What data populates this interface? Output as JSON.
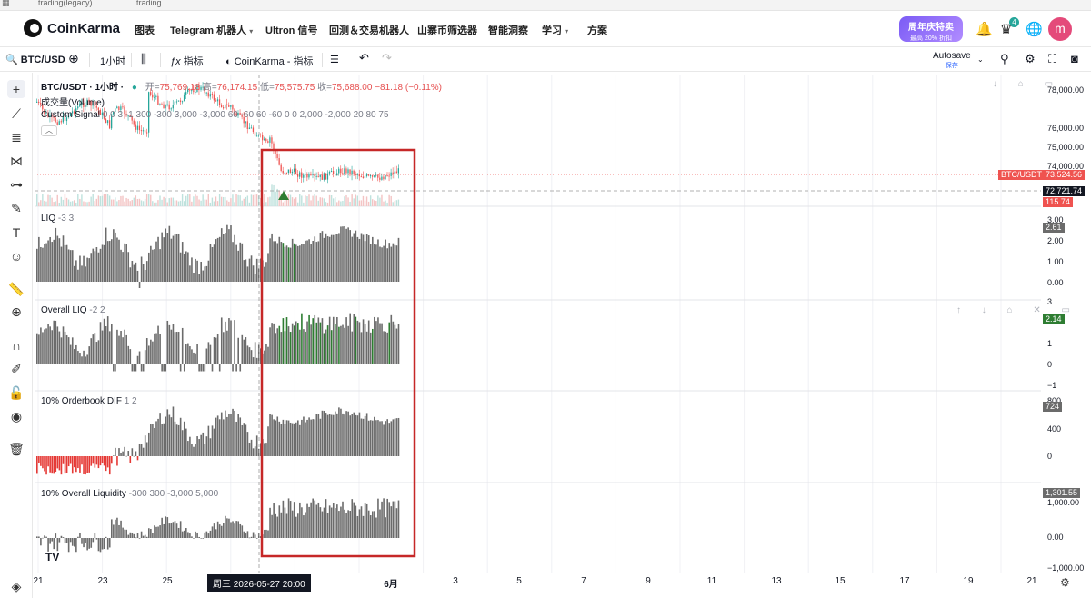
{
  "browser": {
    "tab1": "trading(legacy)",
    "tab2": "trading"
  },
  "nav": {
    "brand": "CoinKarma",
    "items": [
      "图表",
      "Telegram 机器人",
      "Ultron 信号",
      "回测＆交易机器人",
      "山寨币筛选器",
      "智能洞察",
      "学习",
      "方案"
    ],
    "promo_title": "周年庆特卖",
    "promo_sub": "最高 20% 折扣",
    "notif_count": "4",
    "avatar_letter": "m"
  },
  "toolbar": {
    "symbol": "BTC/USD",
    "interval": "1小时",
    "indicators_label": "指标",
    "template_label": "CoinKarma - 指标",
    "autosave": "Autosave",
    "autosave_sub": "保存"
  },
  "chart": {
    "title": "BTC/USDT · 1小时 ·",
    "ohlc": {
      "open_label": "开=",
      "open": "75,769.18",
      "high_label": "高=",
      "high": "76,174.15",
      "low_label": "低=",
      "low": "75,575.75",
      "close_label": "收=",
      "close": "75,688.00",
      "change": "−81.18 (−0.11%)"
    },
    "volume_label": "成交量(Volume)",
    "signal_label": "Custom Signal",
    "signal_params": "0 0 3 -1 300 -300 3,000 -3,000 60 -60 60 -60 0 0 2,000 -2,000 20 80 75",
    "price_tag_symbol": "BTC/USDT",
    "price_tag": "73,524.56",
    "crosshair_price": "72,721.74",
    "volume_tag": "115.74"
  },
  "panes": [
    {
      "name": "LIQ",
      "params": "-3 3",
      "value": "2.61",
      "ticks": [
        "3.00",
        "2.00",
        "1.00",
        "0.00"
      ]
    },
    {
      "name": "Overall LIQ",
      "params": "-2 2",
      "value": "2.14",
      "ticks": [
        "3",
        "1",
        "0",
        "−1"
      ]
    },
    {
      "name": "10% Orderbook DIF",
      "params": "1 2",
      "value": "724",
      "ticks": [
        "800",
        "400",
        "0"
      ]
    },
    {
      "name": "10% Overall Liquidity",
      "params": "-300 300 -3,000 5,000",
      "value": "1,301.55",
      "ticks": [
        "1,000.00",
        "0.00",
        "−1,000.00"
      ]
    }
  ],
  "price_ticks": [
    "78,000.00",
    "76,000.00",
    "75,000.00",
    "74,000.00"
  ],
  "time_axis": [
    "21",
    "23",
    "25",
    "6月",
    "3",
    "5",
    "7",
    "9",
    "11",
    "13",
    "15",
    "17",
    "19",
    "21"
  ],
  "crosshair_time": "周三 2026-05-27   20:00",
  "colors": {
    "up": "#26a69a",
    "down": "#ef5350",
    "green_bar": "#2e7d32",
    "gray_bar": "#6b6b6b",
    "red_bar": "#e53935",
    "highlight": "#c62828"
  }
}
